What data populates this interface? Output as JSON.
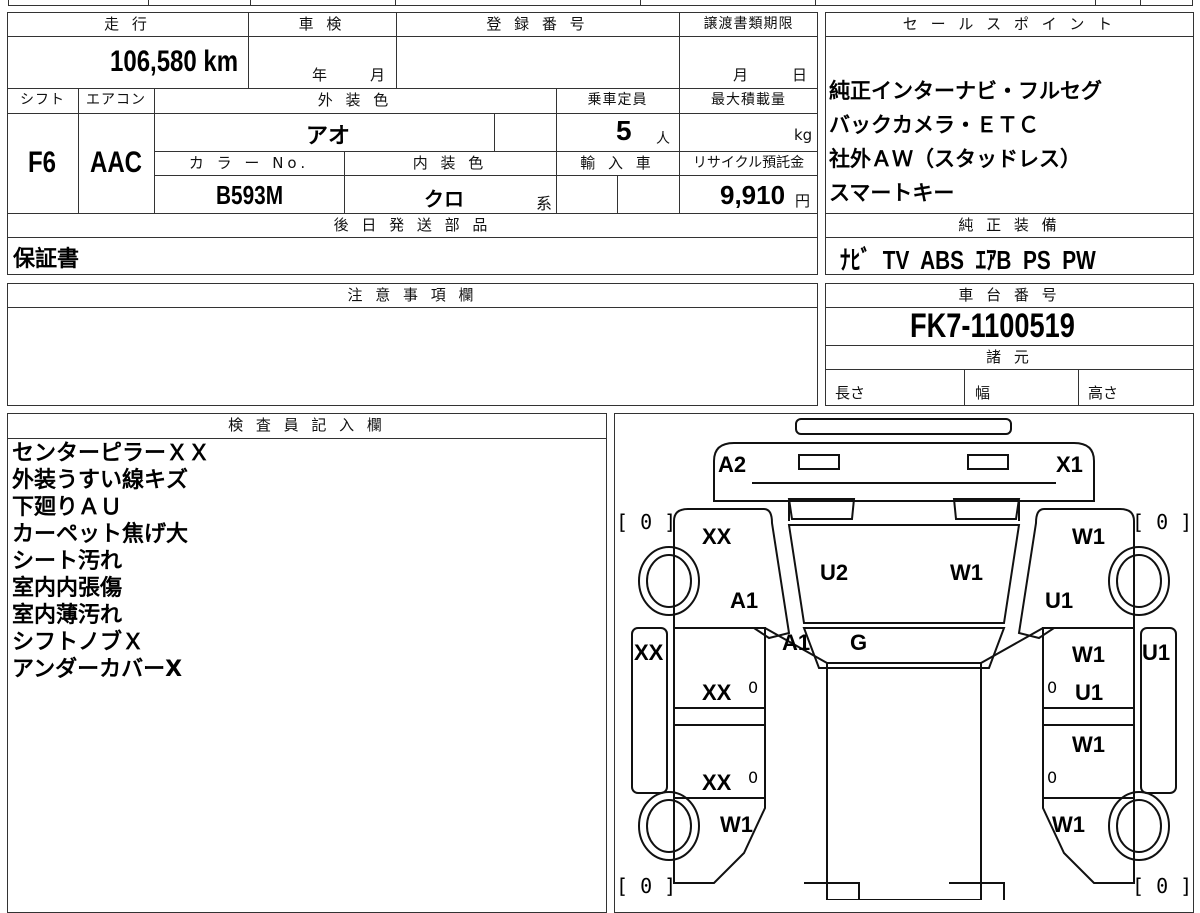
{
  "sheet": {
    "mileage": {
      "header": "走 行",
      "value": "106,580 km"
    },
    "inspection": {
      "header": "車 検",
      "year_label": "年",
      "month_label": "月"
    },
    "registration": {
      "header": "登 録 番 号"
    },
    "transfer_deadline": {
      "header": "譲渡書類期限",
      "month_label": "月",
      "day_label": "日"
    },
    "shift": {
      "header": "シフト",
      "value": "F6"
    },
    "aircon": {
      "header": "エアコン",
      "value": "AAC"
    },
    "exterior_color": {
      "header": "外 装 色",
      "value": "アオ"
    },
    "capacity": {
      "header": "乗車定員",
      "value": "5",
      "unit": "人"
    },
    "max_load": {
      "header": "最大積載量",
      "unit": "kg"
    },
    "color_no": {
      "header": "カ ラ ー No.",
      "value": "B593M"
    },
    "interior_color": {
      "header": "内 装 色",
      "value": "クロ",
      "suffix": "系"
    },
    "import": {
      "header": "輸 入 車"
    },
    "recycle": {
      "header": "リサイクル預託金",
      "value": "9,910",
      "unit": "円"
    },
    "later_parts": {
      "header": "後 日 発 送 部 品",
      "value": "保証書"
    },
    "notes": {
      "header": "注 意 事 項 欄"
    }
  },
  "sales_points": {
    "header": "セ ー ル ス ポ イ ン ト",
    "lines": [
      "純正インターナビ・フルセグ",
      "バックカメラ・ＥＴＣ",
      "社外ＡＷ（スタッドレス）",
      "スマートキー"
    ]
  },
  "equipment": {
    "header": "純 正 装 備",
    "value": "ﾅﾋﾞ  TV  ABS  ｴｱB  PS  PW"
  },
  "chassis": {
    "header": "車 台 番 号",
    "value": "FK7-1100519"
  },
  "specs": {
    "header": "諸 元",
    "length": "長さ",
    "width": "幅",
    "height": "高さ"
  },
  "inspector": {
    "header": "検 査 員 記 入 欄",
    "lines": [
      "センターピラーＸＸ",
      "外装うすい線キズ",
      "下廻りＡＵ",
      "カーペット焦げ大",
      "シート汚れ",
      "室内内張傷",
      "室内薄汚れ",
      "シフトノブＸ",
      "アンダーカバーX"
    ]
  },
  "diagram": {
    "marks": {
      "a2": "A2",
      "x1": "X1",
      "xx_fl": "XX",
      "w1_fr": "W1",
      "u2": "U2",
      "w1_roof": "W1",
      "a1_l": "A1",
      "u1_r": "U1",
      "a1_c": "A1",
      "g": "G",
      "xx_lside": "XX",
      "w1_rd1": "W1",
      "u1_rside": "U1",
      "xx_ld1": "XX",
      "u1_rd1": "U1",
      "w1_rd2": "W1",
      "xx_ld2": "XX",
      "w1_rl": "W1",
      "w1_rr": "W1"
    },
    "brackets": {
      "fl": "[ 0 ]",
      "fr": "[ 0 ]",
      "rl": "[ 0 ]",
      "rr": "[ 0 ]"
    },
    "zeros": {
      "ld1": "0",
      "rd1": "0",
      "ld2": "0",
      "rd2": "0"
    }
  }
}
